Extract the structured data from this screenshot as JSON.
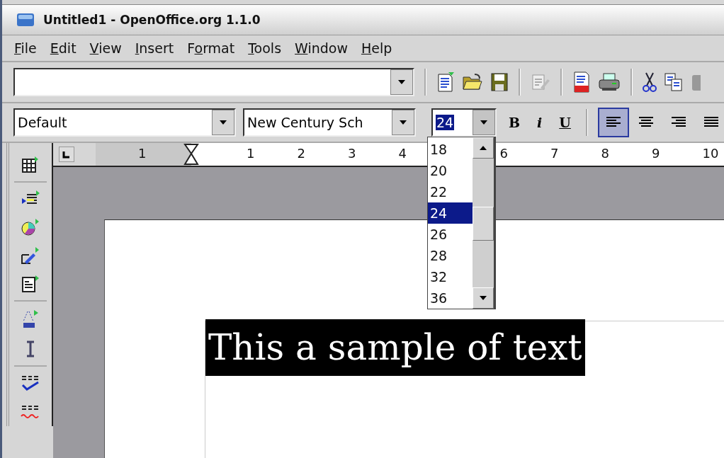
{
  "window": {
    "title": "Untitled1 - OpenOffice.org 1.1.0"
  },
  "menu": [
    {
      "key": "F",
      "after": "ile"
    },
    {
      "key": "E",
      "after": "dit"
    },
    {
      "key": "V",
      "after": "iew"
    },
    {
      "key": "I",
      "after": "nsert"
    },
    {
      "before": "F",
      "key": "o",
      "after": "rmat"
    },
    {
      "key": "T",
      "after": "ools"
    },
    {
      "key": "W",
      "after": "indow"
    },
    {
      "key": "H",
      "after": "elp"
    }
  ],
  "format_bar": {
    "paragraph_style": "Default",
    "font_name": "New Century Sch",
    "font_size": "24",
    "bold": "B",
    "italic": "i",
    "underline": "U",
    "alignment": [
      {
        "kind": "left",
        "selected": true
      },
      {
        "kind": "center",
        "selected": false
      },
      {
        "kind": "right",
        "selected": false
      },
      {
        "kind": "justify",
        "selected": false
      }
    ]
  },
  "font_size_list": [
    {
      "label": "18",
      "selected": false
    },
    {
      "label": "20",
      "selected": false
    },
    {
      "label": "22",
      "selected": false
    },
    {
      "label": "24",
      "selected": true
    },
    {
      "label": "26",
      "selected": false
    },
    {
      "label": "28",
      "selected": false
    },
    {
      "label": "32",
      "selected": false
    },
    {
      "label": "36",
      "selected": false
    }
  ],
  "ruler": {
    "left_label": "1",
    "labels_before_list": [
      "1",
      "2",
      "3",
      "4"
    ],
    "labels_after_list": [
      "6",
      "7",
      "8",
      "9",
      "10"
    ]
  },
  "document": {
    "text": "This a sample of text",
    "selected": true
  }
}
